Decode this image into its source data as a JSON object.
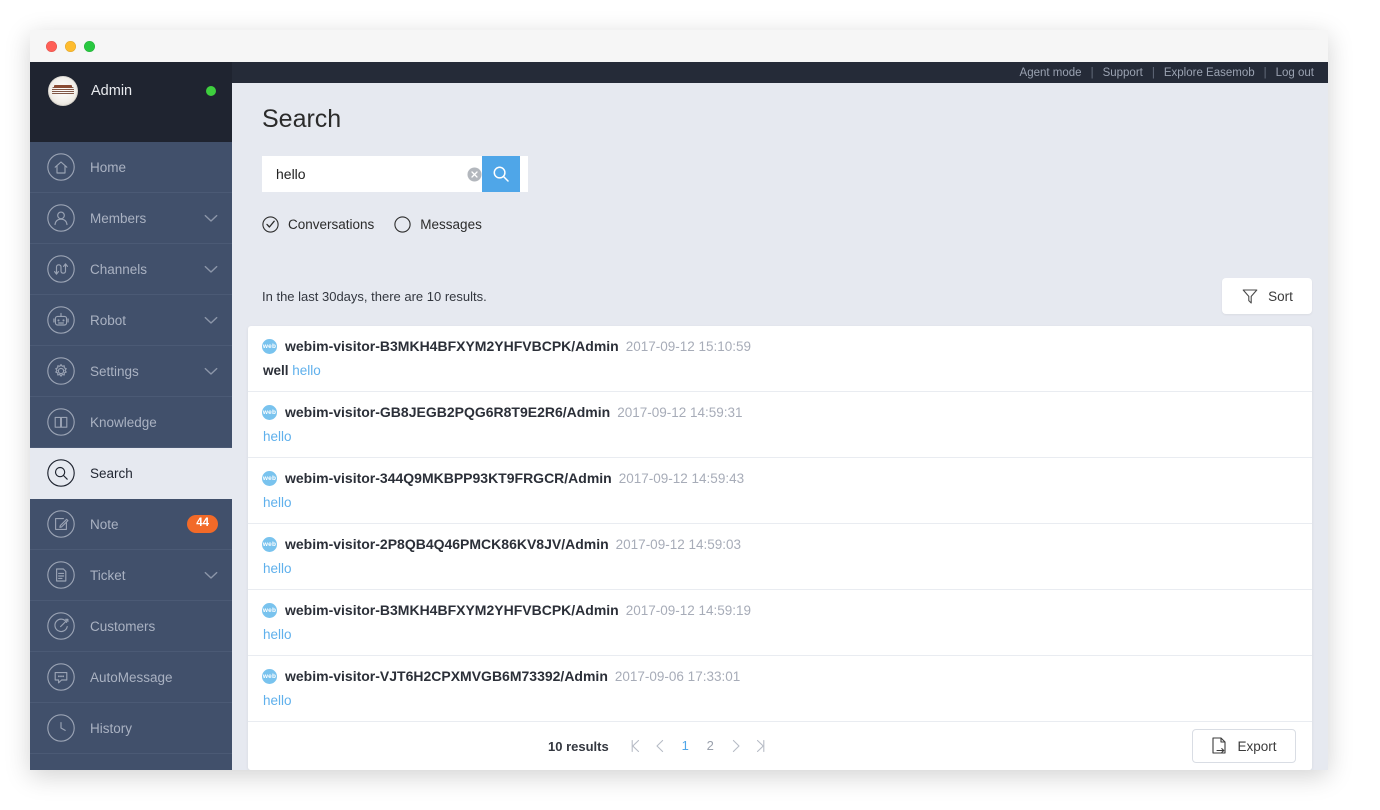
{
  "window": {
    "traffic_lights": [
      "close",
      "minimize",
      "zoom"
    ]
  },
  "topbar": {
    "links": [
      "Agent mode",
      "Support",
      "Explore Easemob",
      "Log out"
    ],
    "separator": "|"
  },
  "sidebar": {
    "account": {
      "name": "Admin",
      "status": "online"
    },
    "items": [
      {
        "label": "Home",
        "icon": "home-icon",
        "expandable": false,
        "active": false
      },
      {
        "label": "Members",
        "icon": "members-icon",
        "expandable": true,
        "active": false
      },
      {
        "label": "Channels",
        "icon": "channels-icon",
        "expandable": true,
        "active": false
      },
      {
        "label": "Robot",
        "icon": "robot-icon",
        "expandable": true,
        "active": false
      },
      {
        "label": "Settings",
        "icon": "gear-icon",
        "expandable": true,
        "active": false
      },
      {
        "label": "Knowledge",
        "icon": "book-icon",
        "expandable": false,
        "active": false
      },
      {
        "label": "Search",
        "icon": "search-icon",
        "expandable": false,
        "active": true
      },
      {
        "label": "Note",
        "icon": "note-icon",
        "expandable": false,
        "active": false,
        "badge": "44"
      },
      {
        "label": "Ticket",
        "icon": "ticket-icon",
        "expandable": true,
        "active": false
      },
      {
        "label": "Customers",
        "icon": "customers-icon",
        "expandable": false,
        "active": false
      },
      {
        "label": "AutoMessage",
        "icon": "automessage-icon",
        "expandable": false,
        "active": false
      },
      {
        "label": "History",
        "icon": "history-icon",
        "expandable": false,
        "active": false
      }
    ]
  },
  "main": {
    "title": "Search",
    "search": {
      "value": "hello",
      "placeholder": "",
      "clear_icon": "clear-circle-icon",
      "button_icon": "search-icon"
    },
    "filters": [
      {
        "label": "Conversations",
        "selected": true
      },
      {
        "label": "Messages",
        "selected": false
      }
    ],
    "summary": "In the last 30days, there are 10 results.",
    "sort": {
      "label": "Sort",
      "icon": "funnel-icon"
    },
    "results": [
      {
        "badge": "web",
        "title": "webim-visitor-B3MKH4BFXYM2YHFVBCPK/Admin",
        "time": "2017-09-12 15:10:59",
        "snippet_plain": "well",
        "snippet_hit": "hello"
      },
      {
        "badge": "web",
        "title": "webim-visitor-GB8JEGB2PQG6R8T9E2R6/Admin",
        "time": "2017-09-12 14:59:31",
        "snippet_plain": "",
        "snippet_hit": "hello"
      },
      {
        "badge": "web",
        "title": "webim-visitor-344Q9MKBPP93KT9FRGCR/Admin",
        "time": "2017-09-12 14:59:43",
        "snippet_plain": "",
        "snippet_hit": "hello"
      },
      {
        "badge": "web",
        "title": "webim-visitor-2P8QB4Q46PMCK86KV8JV/Admin",
        "time": "2017-09-12 14:59:03",
        "snippet_plain": "",
        "snippet_hit": "hello"
      },
      {
        "badge": "web",
        "title": "webim-visitor-B3MKH4BFXYM2YHFVBCPK/Admin",
        "time": "2017-09-12 14:59:19",
        "snippet_plain": "",
        "snippet_hit": "hello"
      },
      {
        "badge": "web",
        "title": "webim-visitor-VJT6H2CPXMVGB6M73392/Admin",
        "time": "2017-09-06 17:33:01",
        "snippet_plain": "",
        "snippet_hit": "hello"
      }
    ],
    "pagination": {
      "count_label": "10 results",
      "pages": [
        "1",
        "2"
      ],
      "current_page": "1",
      "first_icon": "first-page-icon",
      "prev_icon": "prev-page-icon",
      "next_icon": "next-page-icon",
      "last_icon": "last-page-icon"
    },
    "export": {
      "label": "Export",
      "icon": "export-icon"
    }
  },
  "colors": {
    "accent": "#4fa6e8",
    "sidebar": "#41506b",
    "sidebar_header": "#1f2430",
    "topbar": "#252b38",
    "page_bg": "#e6e9f0",
    "badge": "#f26a28",
    "online": "#3ecf3e",
    "hit_text": "#5fb0ec"
  }
}
